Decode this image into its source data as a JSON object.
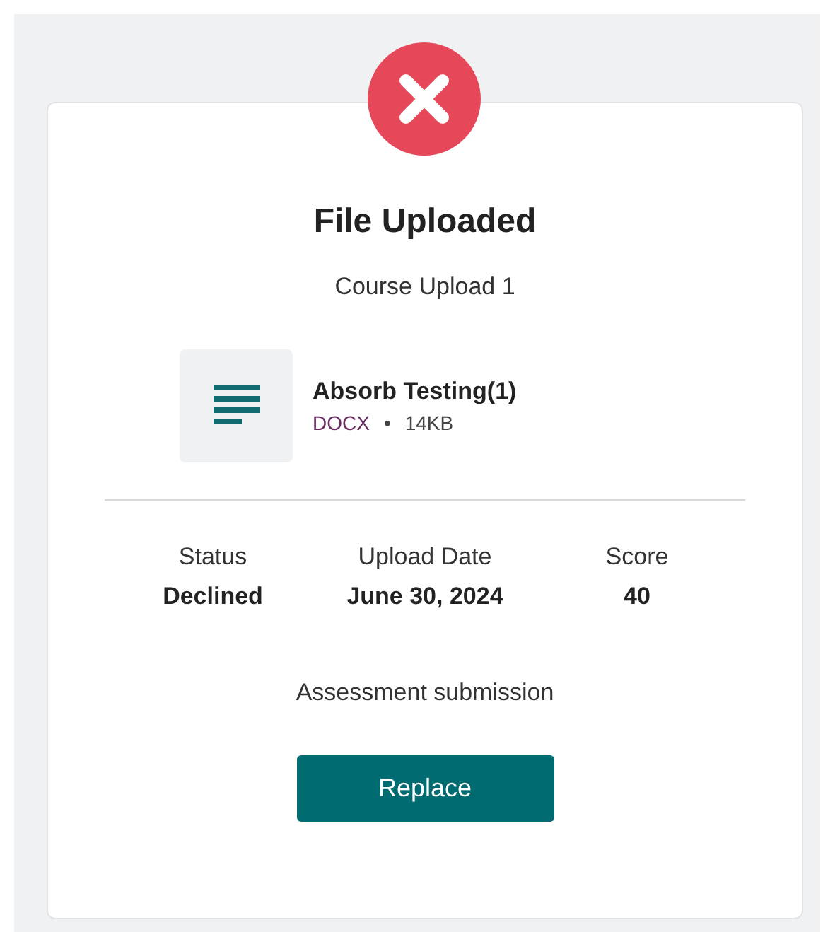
{
  "badge": {
    "kind": "error"
  },
  "title": "File Uploaded",
  "subtitle": "Course Upload 1",
  "file": {
    "name": "Absorb Testing(1)",
    "type": "DOCX",
    "separator": "•",
    "size": "14KB"
  },
  "stats": [
    {
      "label": "Status",
      "value": "Declined"
    },
    {
      "label": "Upload Date",
      "value": "June 30, 2024"
    },
    {
      "label": "Score",
      "value": "40"
    }
  ],
  "note": "Assessment submission",
  "button": "Replace"
}
